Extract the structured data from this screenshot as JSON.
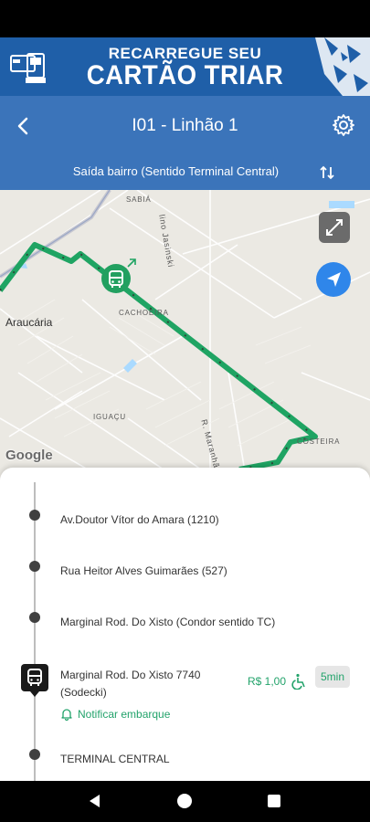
{
  "banner": {
    "line1": "RECARREGUE SEU",
    "line2": "CARTÃO TRIAR",
    "icon": "card-icon"
  },
  "appbar": {
    "title": "I01 - Linhão 1",
    "back_icon": "arrow-back-icon",
    "settings_icon": "gear-icon"
  },
  "direction": {
    "label": "Saída bairro (Sentido Terminal Central)",
    "swap_icon": "swap-vertical-icon"
  },
  "map": {
    "labels": {
      "sabia": "SABIÁ",
      "cachoeira": "CACHOEIRA",
      "iguacu": "IGUAÇU",
      "costeira": "COSTEIRA",
      "araucaria": "Araucária",
      "jasinski": "lino Jasinski",
      "maranhao": "R. Maranhão"
    },
    "attribution": "Google",
    "route_color": "#1fa463",
    "expand_icon": "fullscreen-icon",
    "locate_icon": "navigation-arrow-icon",
    "bus_marker_icon": "bus-icon"
  },
  "stops": [
    {
      "name": "Av.Doutor Vítor do Amara (1210)"
    },
    {
      "name": "Rua Heitor Alves Guimarães (527)"
    },
    {
      "name": "Marginal Rod. Do Xisto (Condor sentido TC)"
    }
  ],
  "current_stop": {
    "name": "Marginal Rod. Do Xisto 7740 (Sodecki)",
    "price": "R$ 1,00",
    "eta": "5min",
    "notify_label": "Notificar embarque",
    "accent": "#23a36b"
  },
  "last_stop": {
    "name": "TERMINAL CENTRAL"
  },
  "colors": {
    "header_blue": "#3b74ba",
    "banner_blue": "#1f5fa8"
  }
}
